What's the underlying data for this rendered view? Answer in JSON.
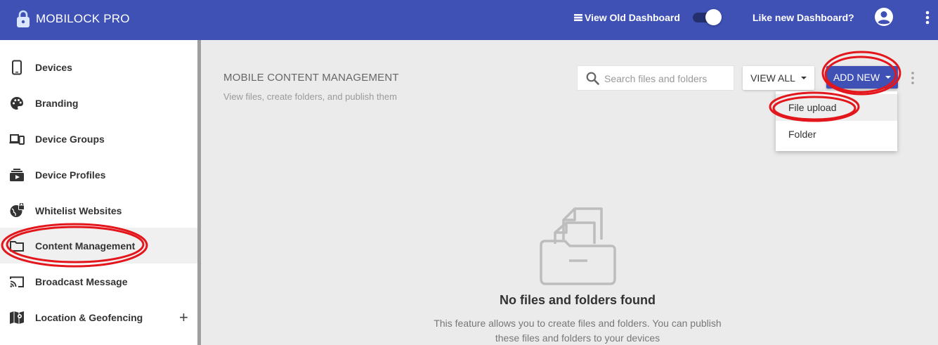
{
  "app": {
    "title": "MOBILOCK PRO",
    "brand_color": "#3f51b5",
    "annotation_color": "#e3161c"
  },
  "header": {
    "view_old_dashboard": "View Old Dashboard",
    "like_new_dashboard": "Like new Dashboard?",
    "toggle_on": true,
    "icons": [
      "lock-icon",
      "list-icon",
      "account-icon",
      "more-vert-icon"
    ]
  },
  "sidebar": {
    "items": [
      {
        "label": "Devices",
        "icon": "phone-icon"
      },
      {
        "label": "Branding",
        "icon": "palette-icon"
      },
      {
        "label": "Device Groups",
        "icon": "devices-icon"
      },
      {
        "label": "Device Profiles",
        "icon": "profiles-icon"
      },
      {
        "label": "Whitelist Websites",
        "icon": "globe-lock-icon"
      },
      {
        "label": "Content Management",
        "icon": "folder-icon",
        "active": true
      },
      {
        "label": "Broadcast Message",
        "icon": "cast-icon"
      },
      {
        "label": "Location & Geofencing",
        "icon": "map-icon",
        "expand": "+"
      }
    ]
  },
  "main": {
    "title": "MOBILE CONTENT MANAGEMENT",
    "subtitle": "View files, create folders, and publish them",
    "search_placeholder": "Search files and folders",
    "view_all_label": "VIEW ALL",
    "add_new_label": "ADD NEW",
    "dropdown": [
      "File upload",
      "Folder"
    ],
    "empty_title": "No files and folders found",
    "empty_line1": "This feature allows you to create files and folders. You can publish",
    "empty_line2": "these files and folders to your devices"
  }
}
